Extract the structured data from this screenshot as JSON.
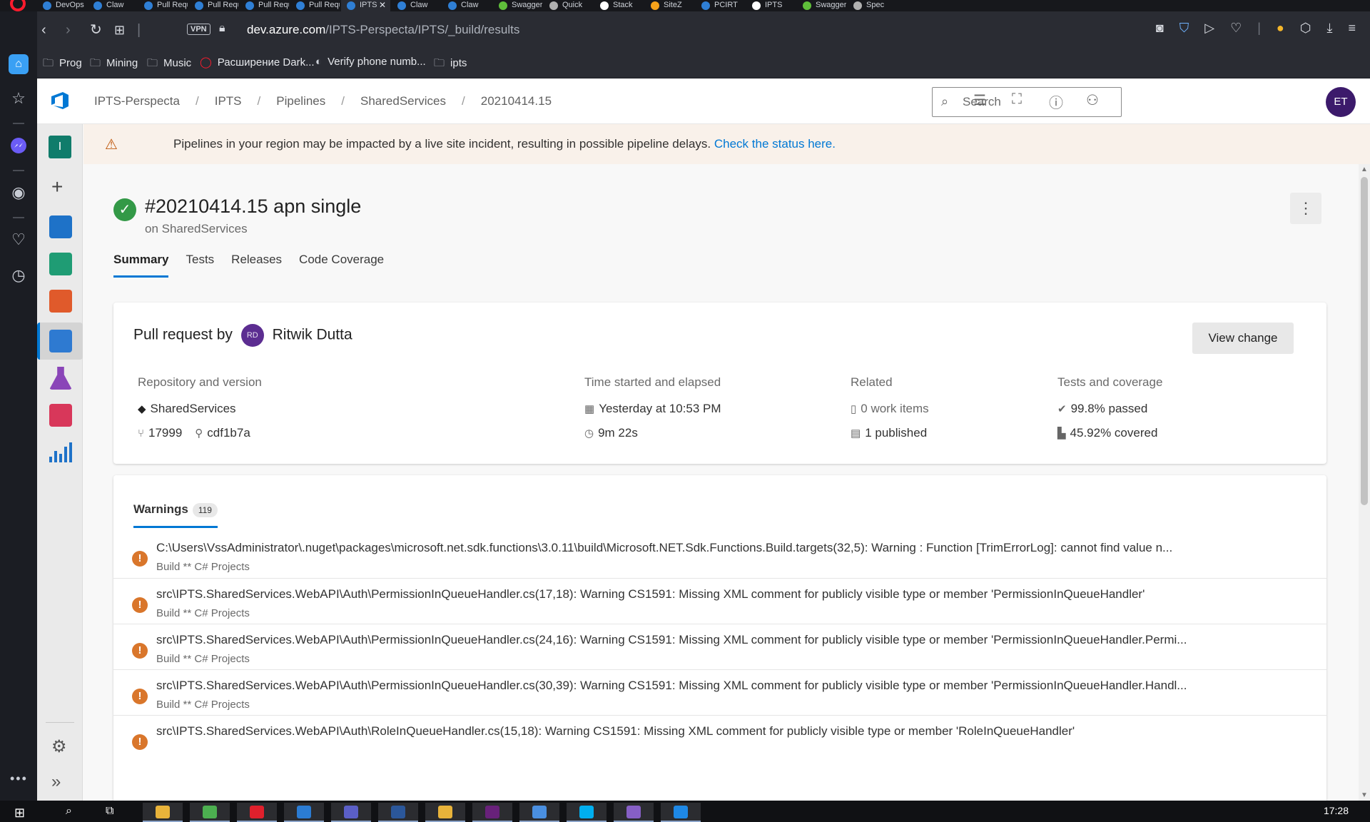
{
  "browser": {
    "tabs": [
      {
        "label": "DevOps",
        "color": "#2f7fd5"
      },
      {
        "label": "Claw",
        "color": "#2f7fd5"
      },
      {
        "label": "Pull Requests",
        "color": "#2f7fd5"
      },
      {
        "label": "Pull Requests",
        "color": "#2f7fd5"
      },
      {
        "label": "Pull Requests",
        "color": "#2f7fd5"
      },
      {
        "label": "Pull Requests",
        "color": "#2f7fd5"
      },
      {
        "label": "IPTS",
        "color": "#2f7fd5"
      },
      {
        "label": "Claw",
        "color": "#2f7fd5"
      },
      {
        "label": "Claw",
        "color": "#2f7fd5"
      },
      {
        "label": "Swagger",
        "color": "#5fbf3a"
      },
      {
        "label": "Quick",
        "color": "#b0b0b0"
      },
      {
        "label": "Stack",
        "color": "#ffffff"
      },
      {
        "label": "SiteZ",
        "color": "#f6a21a"
      },
      {
        "label": "PCIRT",
        "color": "#2f7fd5"
      },
      {
        "label": "IPTS",
        "color": "#ffffff"
      },
      {
        "label": "Swagger",
        "color": "#5fbf3a"
      },
      {
        "label": "Spec",
        "color": "#b0b0b0"
      }
    ],
    "active_tab_index": 6,
    "vpn_label": "VPN",
    "url_host": "dev.azure.com",
    "url_path": "/IPTS-Perspecta/IPTS/_build/results",
    "bookmarks": [
      {
        "label": "Prog",
        "icon": "folder-icon"
      },
      {
        "label": "Mining",
        "icon": "folder-icon"
      },
      {
        "label": "Music",
        "icon": "folder-icon"
      },
      {
        "label": "Расширение Dark...",
        "icon": "opera-icon"
      },
      {
        "label": "Verify phone numb...",
        "icon": "app-icon"
      },
      {
        "label": "ipts",
        "icon": "folder-icon"
      }
    ]
  },
  "ado": {
    "breadcrumb": [
      "IPTS-Perspecta",
      "IPTS",
      "Pipelines",
      "SharedServices",
      "20210414.15"
    ],
    "search_placeholder": "Search",
    "user_initials": "ET",
    "project_initial": "I",
    "banner": {
      "message": "Pipelines in your region may be impacted by a live site incident, resulting in possible pipeline delays.",
      "link": "Check the status here."
    },
    "run": {
      "title": "#20210414.15 apn single",
      "subtitle": "on SharedServices",
      "status": "succeeded",
      "status_color": "#339947"
    },
    "tabs": [
      "Summary",
      "Tests",
      "Releases",
      "Code Coverage"
    ],
    "active_tab": "Summary",
    "summary": {
      "pr_prefix": "Pull request by",
      "author_initials": "RD",
      "author": "Ritwik Dutta",
      "view_change": "View change",
      "repo_header": "Repository and version",
      "repo_name": "SharedServices",
      "pr_number": "17999",
      "commit": "cdf1b7a",
      "time_header": "Time started and elapsed",
      "started": "Yesterday at 10:53 PM",
      "elapsed": "9m 22s",
      "related_header": "Related",
      "work_items": "0 work items",
      "published": "1 published",
      "tests_header": "Tests and coverage",
      "passed": "99.8% passed",
      "covered": "45.92% covered"
    },
    "warnings": {
      "label": "Warnings",
      "count": "119",
      "items": [
        {
          "text": "C:\\Users\\VssAdministrator\\.nuget\\packages\\microsoft.net.sdk.functions\\3.0.11\\build\\Microsoft.NET.Sdk.Functions.Build.targets(32,5): Warning : Function [TrimErrorLog]: cannot find value n...",
          "source": "Build ** C# Projects"
        },
        {
          "text": "src\\IPTS.SharedServices.WebAPI\\Auth\\PermissionInQueueHandler.cs(17,18): Warning CS1591: Missing XML comment for publicly visible type or member 'PermissionInQueueHandler'",
          "source": "Build ** C# Projects"
        },
        {
          "text": "src\\IPTS.SharedServices.WebAPI\\Auth\\PermissionInQueueHandler.cs(24,16): Warning CS1591: Missing XML comment for publicly visible type or member 'PermissionInQueueHandler.Permi...",
          "source": "Build ** C# Projects"
        },
        {
          "text": "src\\IPTS.SharedServices.WebAPI\\Auth\\PermissionInQueueHandler.cs(30,39): Warning CS1591: Missing XML comment for publicly visible type or member 'PermissionInQueueHandler.Handl...",
          "source": "Build ** C# Projects"
        },
        {
          "text": "src\\IPTS.SharedServices.WebAPI\\Auth\\RoleInQueueHandler.cs(15,18): Warning CS1591: Missing XML comment for publicly visible type or member 'RoleInQueueHandler'",
          "source": ""
        }
      ]
    }
  },
  "taskbar": {
    "clock": "17:28",
    "apps": [
      "File Explorer",
      "Chrome",
      "Opera",
      "Outlook",
      "Teams",
      "Word",
      "Explorer",
      "Visual Studio",
      "Notes",
      "Skype",
      "Visual Studio",
      "Browser"
    ]
  }
}
